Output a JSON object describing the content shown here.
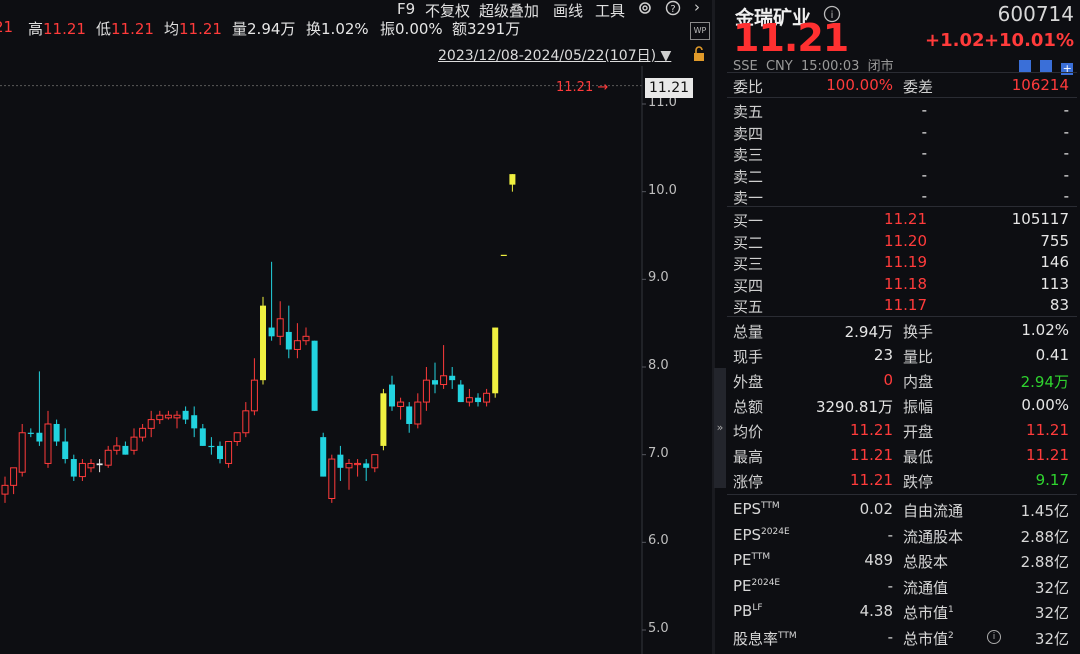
{
  "menu": {
    "items": [
      "F9",
      "不复权",
      "超级叠加",
      "画线",
      "工具"
    ]
  },
  "info_bar": {
    "items": [
      {
        "label": "",
        "value": "21",
        "color": "red"
      },
      {
        "label": "高",
        "value": "11.21",
        "color": "red"
      },
      {
        "label": "低",
        "value": "11.21",
        "color": "red"
      },
      {
        "label": "均",
        "value": "11.21",
        "color": "red"
      },
      {
        "label": "量",
        "value": "2.94万",
        "color": "white"
      },
      {
        "label": "换",
        "value": "1.02%",
        "color": "white"
      },
      {
        "label": "振",
        "value": "0.00%",
        "color": "white"
      },
      {
        "label": "额",
        "value": "3291万",
        "color": "white"
      }
    ],
    "date_range": "2023/12/08-2024/05/22(107日)",
    "wp_badge": "WP"
  },
  "chart_data": {
    "type": "candlestick",
    "y_ticks": [
      "11.0",
      "10.0",
      "9.0",
      "8.0",
      "7.0",
      "6.0",
      "5.0"
    ],
    "ylim": [
      4.8,
      11.4
    ],
    "last_price_label": "11.21",
    "last_price_tag": "11.21",
    "colors": {
      "up": "#ff3b3b",
      "down": "#22d3df",
      "limit_up": "#f0f040"
    },
    "candles": [
      {
        "o": 6.55,
        "h": 6.75,
        "l": 6.45,
        "c": 6.65,
        "t": "up"
      },
      {
        "o": 6.65,
        "h": 6.85,
        "l": 6.55,
        "c": 6.85,
        "t": "up"
      },
      {
        "o": 6.8,
        "h": 7.35,
        "l": 6.75,
        "c": 7.25,
        "t": "up"
      },
      {
        "o": 7.25,
        "h": 7.3,
        "l": 7.2,
        "c": 7.25,
        "t": "down"
      },
      {
        "o": 7.25,
        "h": 7.95,
        "l": 7.1,
        "c": 7.15,
        "t": "down"
      },
      {
        "o": 6.9,
        "h": 7.5,
        "l": 6.85,
        "c": 7.35,
        "t": "up"
      },
      {
        "o": 7.35,
        "h": 7.4,
        "l": 7.1,
        "c": 7.15,
        "t": "down"
      },
      {
        "o": 7.15,
        "h": 7.3,
        "l": 6.9,
        "c": 6.95,
        "t": "down"
      },
      {
        "o": 6.95,
        "h": 7.0,
        "l": 6.7,
        "c": 6.75,
        "t": "down"
      },
      {
        "o": 6.75,
        "h": 6.95,
        "l": 6.7,
        "c": 6.9,
        "t": "up"
      },
      {
        "o": 6.85,
        "h": 6.95,
        "l": 6.8,
        "c": 6.9,
        "t": "up"
      },
      {
        "o": 6.9,
        "h": 6.95,
        "l": 6.8,
        "c": 6.88,
        "t": "doji"
      },
      {
        "o": 6.88,
        "h": 7.1,
        "l": 6.85,
        "c": 7.05,
        "t": "up"
      },
      {
        "o": 7.05,
        "h": 7.2,
        "l": 7.0,
        "c": 7.1,
        "t": "up"
      },
      {
        "o": 7.1,
        "h": 7.15,
        "l": 7.0,
        "c": 7.0,
        "t": "down"
      },
      {
        "o": 7.05,
        "h": 7.3,
        "l": 7.0,
        "c": 7.2,
        "t": "up"
      },
      {
        "o": 7.2,
        "h": 7.35,
        "l": 7.15,
        "c": 7.3,
        "t": "up"
      },
      {
        "o": 7.3,
        "h": 7.5,
        "l": 7.2,
        "c": 7.4,
        "t": "up"
      },
      {
        "o": 7.4,
        "h": 7.5,
        "l": 7.35,
        "c": 7.45,
        "t": "up"
      },
      {
        "o": 7.45,
        "h": 7.5,
        "l": 7.4,
        "c": 7.42,
        "t": "up"
      },
      {
        "o": 7.42,
        "h": 7.5,
        "l": 7.3,
        "c": 7.45,
        "t": "up"
      },
      {
        "o": 7.5,
        "h": 7.55,
        "l": 7.35,
        "c": 7.4,
        "t": "down"
      },
      {
        "o": 7.45,
        "h": 7.55,
        "l": 7.2,
        "c": 7.3,
        "t": "down"
      },
      {
        "o": 7.3,
        "h": 7.35,
        "l": 7.1,
        "c": 7.1,
        "t": "down"
      },
      {
        "o": 7.1,
        "h": 7.2,
        "l": 7.0,
        "c": 7.1,
        "t": "down"
      },
      {
        "o": 7.1,
        "h": 7.15,
        "l": 6.9,
        "c": 6.95,
        "t": "down"
      },
      {
        "o": 6.9,
        "h": 7.1,
        "l": 6.85,
        "c": 7.15,
        "t": "up"
      },
      {
        "o": 7.15,
        "h": 7.25,
        "l": 7.1,
        "c": 7.25,
        "t": "up"
      },
      {
        "o": 7.25,
        "h": 7.6,
        "l": 7.2,
        "c": 7.5,
        "t": "up"
      },
      {
        "o": 7.5,
        "h": 8.1,
        "l": 7.45,
        "c": 7.85,
        "t": "up"
      },
      {
        "o": 7.85,
        "h": 8.8,
        "l": 7.8,
        "c": 8.7,
        "t": "limit"
      },
      {
        "o": 8.45,
        "h": 9.2,
        "l": 8.3,
        "c": 8.35,
        "t": "down"
      },
      {
        "o": 8.35,
        "h": 8.75,
        "l": 8.25,
        "c": 8.55,
        "t": "up"
      },
      {
        "o": 8.4,
        "h": 8.7,
        "l": 8.1,
        "c": 8.2,
        "t": "down"
      },
      {
        "o": 8.2,
        "h": 8.5,
        "l": 8.1,
        "c": 8.3,
        "t": "up"
      },
      {
        "o": 8.3,
        "h": 8.45,
        "l": 8.25,
        "c": 8.35,
        "t": "up"
      },
      {
        "o": 8.3,
        "h": 8.3,
        "l": 7.5,
        "c": 7.5,
        "t": "down"
      },
      {
        "o": 7.2,
        "h": 7.25,
        "l": 6.75,
        "c": 6.75,
        "t": "down"
      },
      {
        "o": 6.5,
        "h": 7.0,
        "l": 6.45,
        "c": 6.95,
        "t": "up"
      },
      {
        "o": 7.0,
        "h": 7.1,
        "l": 6.7,
        "c": 6.85,
        "t": "down"
      },
      {
        "o": 6.85,
        "h": 6.95,
        "l": 6.6,
        "c": 6.9,
        "t": "up"
      },
      {
        "o": 6.9,
        "h": 6.95,
        "l": 6.75,
        "c": 6.9,
        "t": "up"
      },
      {
        "o": 6.9,
        "h": 6.95,
        "l": 6.7,
        "c": 6.85,
        "t": "down"
      },
      {
        "o": 6.85,
        "h": 7.0,
        "l": 6.8,
        "c": 7.0,
        "t": "up"
      },
      {
        "o": 7.1,
        "h": 7.75,
        "l": 7.05,
        "c": 7.7,
        "t": "limit"
      },
      {
        "o": 7.8,
        "h": 7.9,
        "l": 7.5,
        "c": 7.55,
        "t": "down"
      },
      {
        "o": 7.55,
        "h": 7.65,
        "l": 7.4,
        "c": 7.6,
        "t": "up"
      },
      {
        "o": 7.55,
        "h": 7.6,
        "l": 7.25,
        "c": 7.35,
        "t": "down"
      },
      {
        "o": 7.35,
        "h": 7.7,
        "l": 7.3,
        "c": 7.6,
        "t": "up"
      },
      {
        "o": 7.6,
        "h": 8.0,
        "l": 7.5,
        "c": 7.85,
        "t": "up"
      },
      {
        "o": 7.85,
        "h": 8.05,
        "l": 7.7,
        "c": 7.8,
        "t": "down"
      },
      {
        "o": 7.8,
        "h": 8.25,
        "l": 7.75,
        "c": 7.9,
        "t": "up"
      },
      {
        "o": 7.9,
        "h": 8.0,
        "l": 7.75,
        "c": 7.85,
        "t": "down"
      },
      {
        "o": 7.8,
        "h": 7.85,
        "l": 7.6,
        "c": 7.6,
        "t": "down"
      },
      {
        "o": 7.6,
        "h": 7.75,
        "l": 7.55,
        "c": 7.65,
        "t": "up"
      },
      {
        "o": 7.6,
        "h": 7.7,
        "l": 7.55,
        "c": 7.65,
        "t": "down"
      },
      {
        "o": 7.6,
        "h": 7.75,
        "l": 7.55,
        "c": 7.7,
        "t": "up"
      },
      {
        "o": 7.7,
        "h": 8.45,
        "l": 7.65,
        "c": 8.45,
        "t": "limit"
      },
      {
        "o": 9.28,
        "h": 9.28,
        "l": 9.28,
        "c": 9.28,
        "t": "limit"
      },
      {
        "o": 10.08,
        "h": 10.2,
        "l": 10.0,
        "c": 10.2,
        "t": "limit"
      }
    ]
  },
  "panel": {
    "name": "金瑞矿业",
    "code": "600714",
    "price": "11.21",
    "change": "+1.02",
    "change_pct": "+10.01%",
    "status_line": "SSE  CNY  15:00:03  闭市",
    "weibi": {
      "label": "委比",
      "value": "100.00%",
      "label2": "委差",
      "value2": "106214"
    },
    "sells": [
      {
        "label": "卖五",
        "price": "-",
        "vol": "-"
      },
      {
        "label": "卖四",
        "price": "-",
        "vol": "-"
      },
      {
        "label": "卖三",
        "price": "-",
        "vol": "-"
      },
      {
        "label": "卖二",
        "price": "-",
        "vol": "-"
      },
      {
        "label": "卖一",
        "price": "-",
        "vol": "-"
      }
    ],
    "buys": [
      {
        "label": "买一",
        "price": "11.21",
        "vol": "105117"
      },
      {
        "label": "买二",
        "price": "11.20",
        "vol": "755"
      },
      {
        "label": "买三",
        "price": "11.19",
        "vol": "146"
      },
      {
        "label": "买四",
        "price": "11.18",
        "vol": "113"
      },
      {
        "label": "买五",
        "price": "11.17",
        "vol": "83"
      }
    ],
    "stats": [
      {
        "l1": "总量",
        "v1": "2.94万",
        "c1": "white",
        "l2": "换手",
        "v2": "1.02%",
        "c2": "white"
      },
      {
        "l1": "现手",
        "v1": "23",
        "c1": "white",
        "l2": "量比",
        "v2": "0.41",
        "c2": "white"
      },
      {
        "l1": "外盘",
        "v1": "0",
        "c1": "red",
        "l2": "内盘",
        "v2": "2.94万",
        "c2": "green"
      },
      {
        "l1": "总额",
        "v1": "3290.81万",
        "c1": "white",
        "l2": "振幅",
        "v2": "0.00%",
        "c2": "white"
      },
      {
        "l1": "均价",
        "v1": "11.21",
        "c1": "red",
        "l2": "开盘",
        "v2": "11.21",
        "c2": "red"
      },
      {
        "l1": "最高",
        "v1": "11.21",
        "c1": "red",
        "l2": "最低",
        "v2": "11.21",
        "c2": "red"
      },
      {
        "l1": "涨停",
        "v1": "11.21",
        "c1": "red",
        "l2": "跌停",
        "v2": "9.17",
        "c2": "green"
      }
    ],
    "fundamentals": [
      {
        "l1": "EPS",
        "s1": "TTM",
        "v1": "0.02",
        "l2": "自由流通",
        "s2": "",
        "v2": "1.45亿"
      },
      {
        "l1": "EPS",
        "s1": "2024E",
        "v1": "-",
        "l2": "流通股本",
        "s2": "",
        "v2": "2.88亿"
      },
      {
        "l1": "PE",
        "s1": "TTM",
        "v1": "489",
        "l2": "总股本",
        "s2": "",
        "v2": "2.88亿"
      },
      {
        "l1": "PE",
        "s1": "2024E",
        "v1": "-",
        "l2": "流通值",
        "s2": "",
        "v2": "32亿"
      },
      {
        "l1": "PB",
        "s1": "LF",
        "v1": "4.38",
        "l2": "总市值",
        "s2": "1",
        "v2": "32亿"
      },
      {
        "l1": "股息率",
        "s1": "TTM",
        "v1": "-",
        "l2": "总市值",
        "s2": "2",
        "v2": "32亿"
      }
    ]
  }
}
